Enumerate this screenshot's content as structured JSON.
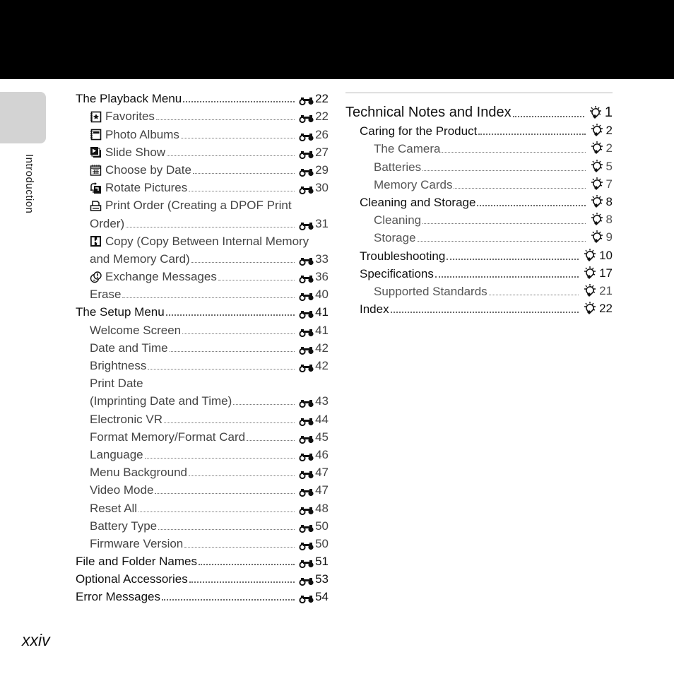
{
  "side_tab": {
    "label": "Introduction"
  },
  "page_number": "xxiv",
  "left_column": {
    "entries": [
      {
        "level": 1,
        "label": "The Playback Menu",
        "icon": "",
        "page": "22",
        "ref_icon": "binoculars-icon"
      },
      {
        "level": 2,
        "label": "Favorites",
        "icon": "favorites-icon",
        "page": "22",
        "ref_icon": "binoculars-icon"
      },
      {
        "level": 2,
        "label": "Photo Albums",
        "icon": "photo-albums-icon",
        "page": "26",
        "ref_icon": "binoculars-icon"
      },
      {
        "level": 2,
        "label": "Slide Show",
        "icon": "slide-show-icon",
        "page": "27",
        "ref_icon": "binoculars-icon"
      },
      {
        "level": 2,
        "label": "Choose by Date",
        "icon": "calendar-icon",
        "page": "29",
        "ref_icon": "binoculars-icon"
      },
      {
        "level": 2,
        "label": "Rotate Pictures",
        "icon": "rotate-icon",
        "page": "30",
        "ref_icon": "binoculars-icon"
      },
      {
        "level": 2,
        "label": "Print Order (Creating a DPOF Print",
        "icon": "print-icon",
        "page": "",
        "ref_icon": ""
      },
      {
        "level": 2,
        "label": "Order)",
        "icon": "",
        "page": "31",
        "ref_icon": "binoculars-icon"
      },
      {
        "level": 2,
        "label": "Copy (Copy Between Internal Memory",
        "icon": "copy-icon",
        "page": "",
        "ref_icon": ""
      },
      {
        "level": 2,
        "label": "and Memory Card)",
        "icon": "",
        "page": "33",
        "ref_icon": "binoculars-icon"
      },
      {
        "level": 2,
        "label": "Exchange Messages",
        "icon": "messages-icon",
        "page": "36",
        "ref_icon": "binoculars-icon"
      },
      {
        "level": 2,
        "label": "Erase",
        "icon": "",
        "page": "40",
        "ref_icon": "binoculars-icon"
      },
      {
        "level": 1,
        "label": "The Setup Menu",
        "icon": "",
        "page": "41",
        "ref_icon": "binoculars-icon"
      },
      {
        "level": 2,
        "label": "Welcome Screen",
        "icon": "",
        "page": "41",
        "ref_icon": "binoculars-icon"
      },
      {
        "level": 2,
        "label": "Date and Time",
        "icon": "",
        "page": "42",
        "ref_icon": "binoculars-icon"
      },
      {
        "level": 2,
        "label": "Brightness",
        "icon": "",
        "page": "42",
        "ref_icon": "binoculars-icon"
      },
      {
        "level": 2,
        "label": "Print Date",
        "icon": "",
        "page": "",
        "ref_icon": ""
      },
      {
        "level": 2,
        "label": "(Imprinting Date and Time)",
        "icon": "",
        "page": "43",
        "ref_icon": "binoculars-icon"
      },
      {
        "level": 2,
        "label": "Electronic VR",
        "icon": "",
        "page": "44",
        "ref_icon": "binoculars-icon"
      },
      {
        "level": 2,
        "label": "Format Memory/Format Card",
        "icon": "",
        "page": "45",
        "ref_icon": "binoculars-icon"
      },
      {
        "level": 2,
        "label": "Language",
        "icon": "",
        "page": "46",
        "ref_icon": "binoculars-icon"
      },
      {
        "level": 2,
        "label": "Menu Background",
        "icon": "",
        "page": "47",
        "ref_icon": "binoculars-icon"
      },
      {
        "level": 2,
        "label": "Video Mode",
        "icon": "",
        "page": "47",
        "ref_icon": "binoculars-icon"
      },
      {
        "level": 2,
        "label": "Reset All",
        "icon": "",
        "page": "48",
        "ref_icon": "binoculars-icon"
      },
      {
        "level": 2,
        "label": "Battery Type",
        "icon": "",
        "page": "50",
        "ref_icon": "binoculars-icon"
      },
      {
        "level": 2,
        "label": "Firmware Version",
        "icon": "",
        "page": "50",
        "ref_icon": "binoculars-icon"
      },
      {
        "level": 1,
        "label": "File and Folder Names",
        "icon": "",
        "page": "51",
        "ref_icon": "binoculars-icon"
      },
      {
        "level": 1,
        "label": "Optional Accessories",
        "icon": "",
        "page": "53",
        "ref_icon": "binoculars-icon"
      },
      {
        "level": 1,
        "label": "Error Messages",
        "icon": "",
        "page": "54",
        "ref_icon": "binoculars-icon"
      }
    ]
  },
  "right_column": {
    "entries": [
      {
        "level": 0,
        "label": "Technical Notes and Index",
        "page": "1",
        "ref_icon": "lightbulb-icon"
      },
      {
        "level": 1,
        "label": "Caring for the Product",
        "page": "2",
        "ref_icon": "lightbulb-icon"
      },
      {
        "level": 2,
        "label": "The Camera",
        "page": "2",
        "ref_icon": "lightbulb-icon"
      },
      {
        "level": 2,
        "label": "Batteries",
        "page": "5",
        "ref_icon": "lightbulb-icon"
      },
      {
        "level": 2,
        "label": "Memory Cards",
        "page": "7",
        "ref_icon": "lightbulb-icon"
      },
      {
        "level": 1,
        "label": "Cleaning and Storage",
        "page": "8",
        "ref_icon": "lightbulb-icon"
      },
      {
        "level": 2,
        "label": "Cleaning",
        "page": "8",
        "ref_icon": "lightbulb-icon"
      },
      {
        "level": 2,
        "label": "Storage",
        "page": "9",
        "ref_icon": "lightbulb-icon"
      },
      {
        "level": 1,
        "label": "Troubleshooting",
        "page": "10",
        "ref_icon": "lightbulb-icon"
      },
      {
        "level": 1,
        "label": "Specifications",
        "page": "17",
        "ref_icon": "lightbulb-icon"
      },
      {
        "level": 2,
        "label": "Supported Standards",
        "page": "21",
        "ref_icon": "lightbulb-icon"
      },
      {
        "level": 1,
        "label": "Index",
        "page": "22",
        "ref_icon": "lightbulb-icon"
      }
    ]
  }
}
